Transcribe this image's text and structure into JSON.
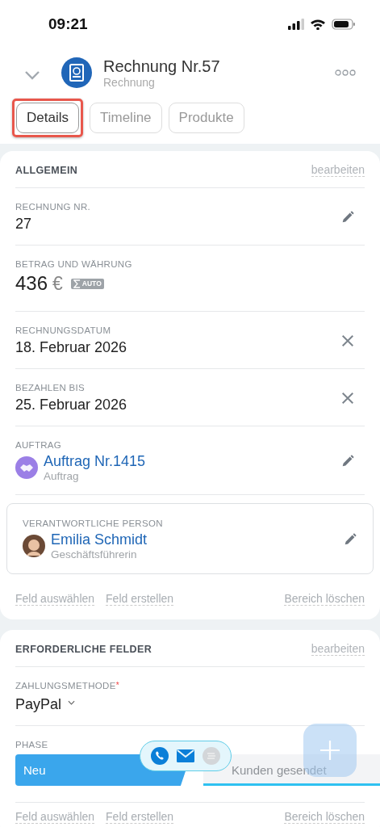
{
  "status_bar": {
    "time": "09:21"
  },
  "header": {
    "title": "Rechnung Nr.57",
    "subtitle": "Rechnung"
  },
  "tabs": [
    {
      "label": "Details",
      "selected": true,
      "highlighted": true
    },
    {
      "label": "Timeline",
      "selected": false,
      "highlighted": false
    },
    {
      "label": "Produkte",
      "selected": false,
      "highlighted": false
    }
  ],
  "sections": [
    {
      "title": "ALLGEMEIN",
      "action": "bearbeiten",
      "fields": [
        {
          "kind": "text",
          "label": "RECHNUNG NR.",
          "value": "27"
        },
        {
          "kind": "money",
          "label": "BETRAG UND WÄHRUNG",
          "value": "436",
          "currency": "€",
          "badge": "AUTO"
        },
        {
          "kind": "date",
          "label": "RECHNUNGSDATUM",
          "value": "18. Februar 2026"
        },
        {
          "kind": "date",
          "label": "BEZAHLEN BIS",
          "value": "25. Februar 2026"
        },
        {
          "kind": "entity",
          "label": "AUFTRAG",
          "value": "Auftrag Nr.1415",
          "subtitle": "Auftrag"
        },
        {
          "kind": "person",
          "label": "VERANTWORTLICHE PERSON",
          "value": "Emilia Schmidt",
          "subtitle": "Geschäftsführerin"
        }
      ],
      "links": [
        "Feld auswählen",
        "Feld erstellen",
        "Bereich löschen"
      ]
    },
    {
      "title": "ERFORDERLICHE FELDER",
      "action": "bearbeiten",
      "fields": [
        {
          "kind": "select",
          "label": "ZAHLUNGSMETHODE",
          "required_mark": "*",
          "value": "PayPal"
        },
        {
          "kind": "stages",
          "label": "PHASE",
          "stages": [
            {
              "label": "Neu",
              "selected": true
            },
            {
              "label": "Kunden gesendet",
              "selected": false
            }
          ]
        }
      ],
      "links": [
        "Feld auswählen",
        "Feld erstellen",
        "Bereich löschen"
      ]
    }
  ]
}
